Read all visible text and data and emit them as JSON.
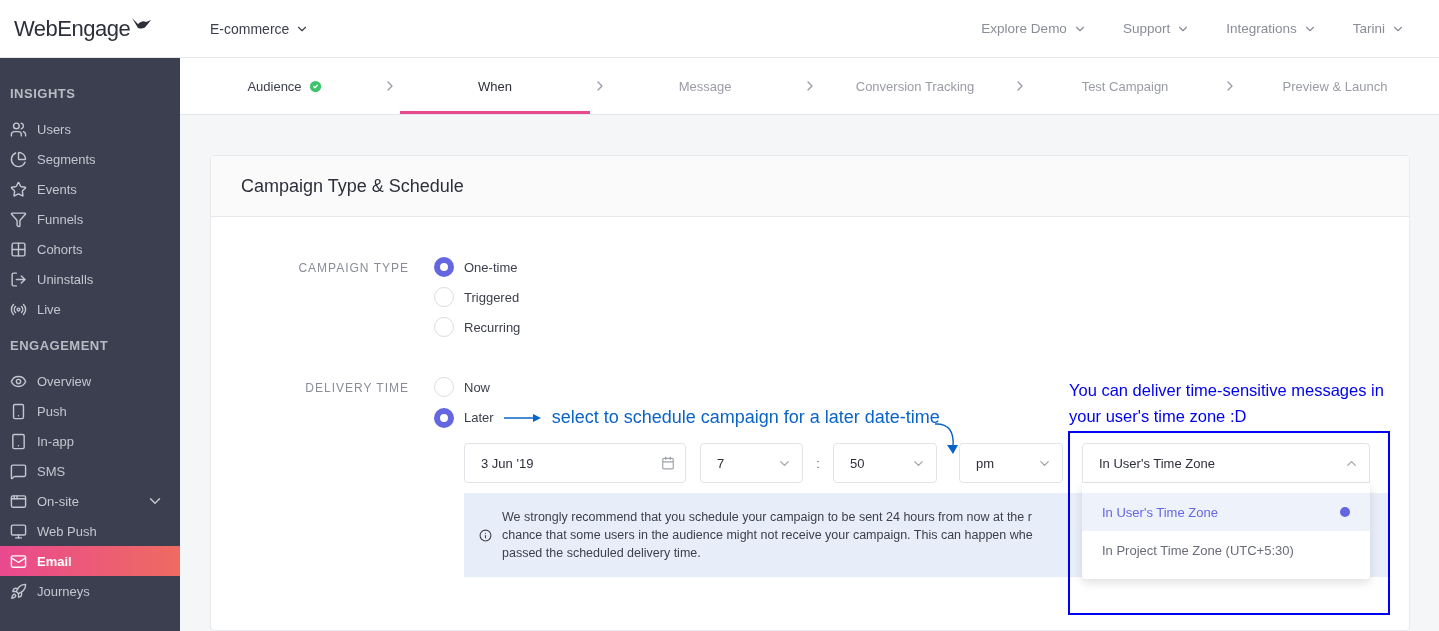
{
  "header": {
    "logo": "WebEngage",
    "project": "E-commerce",
    "nav": [
      {
        "label": "Explore Demo"
      },
      {
        "label": "Support"
      },
      {
        "label": "Integrations"
      },
      {
        "label": "Tarini"
      }
    ]
  },
  "sidebar": {
    "sections": [
      {
        "title": "INSIGHTS",
        "items": [
          {
            "label": "Users",
            "selected": false,
            "kind": "link"
          },
          {
            "label": "Segments",
            "selected": false,
            "kind": "link"
          },
          {
            "label": "Events",
            "selected": false,
            "kind": "link"
          },
          {
            "label": "Funnels",
            "selected": false,
            "kind": "link"
          },
          {
            "label": "Cohorts",
            "selected": false,
            "kind": "link"
          },
          {
            "label": "Uninstalls",
            "selected": false,
            "kind": "link"
          },
          {
            "label": "Live",
            "selected": false,
            "kind": "link"
          }
        ]
      },
      {
        "title": "ENGAGEMENT",
        "items": [
          {
            "label": "Overview",
            "selected": false,
            "kind": "link"
          },
          {
            "label": "Push",
            "selected": false,
            "kind": "link"
          },
          {
            "label": "In-app",
            "selected": false,
            "kind": "link"
          },
          {
            "label": "SMS",
            "selected": false,
            "kind": "link"
          },
          {
            "label": "On-site",
            "selected": false,
            "kind": "group",
            "expanded": false
          },
          {
            "label": "Web Push",
            "selected": false,
            "kind": "link"
          },
          {
            "label": "Email",
            "selected": true,
            "kind": "link"
          },
          {
            "label": "Journeys",
            "selected": false,
            "kind": "link"
          }
        ]
      }
    ]
  },
  "steps": [
    {
      "label": "Audience",
      "selected": false,
      "done": true
    },
    {
      "label": "When",
      "selected": true,
      "done": false
    },
    {
      "label": "Message",
      "selected": false,
      "done": false
    },
    {
      "label": "Conversion Tracking",
      "selected": false,
      "done": false
    },
    {
      "label": "Test Campaign",
      "selected": false,
      "done": false
    },
    {
      "label": "Preview & Launch",
      "selected": false,
      "done": false
    }
  ],
  "card": {
    "title": "Campaign Type & Schedule",
    "campaign_type": {
      "label": "CAMPAIGN TYPE",
      "options": [
        {
          "label": "One-time",
          "selected": true
        },
        {
          "label": "Triggered",
          "selected": false
        },
        {
          "label": "Recurring",
          "selected": false
        }
      ]
    },
    "delivery_time": {
      "label": "DELIVERY TIME",
      "options": [
        {
          "label": "Now",
          "selected": false
        },
        {
          "label": "Later",
          "selected": true
        }
      ]
    },
    "schedule": {
      "date": "3 Jun '19",
      "hour": "7",
      "separator": ":",
      "minute": "50",
      "meridiem": "pm"
    },
    "timezone": {
      "value": "In User's Time Zone",
      "expanded": true,
      "options": [
        {
          "label": "In User's Time Zone",
          "selected": true
        },
        {
          "label": "In Project Time Zone (UTC+5:30)",
          "selected": false
        }
      ]
    },
    "info": {
      "lines": [
        "We strongly recommend that you schedule your campaign to be sent 24 hours from now at the r",
        "chance that some users in the audience might not receive your campaign. This can happen whe",
        "passed the scheduled delivery time."
      ]
    }
  },
  "annotations": {
    "arrow_note": "select to schedule campaign for a later date-time",
    "tip": "You can deliver time-sensitive messages in your user's time zone :D"
  }
}
